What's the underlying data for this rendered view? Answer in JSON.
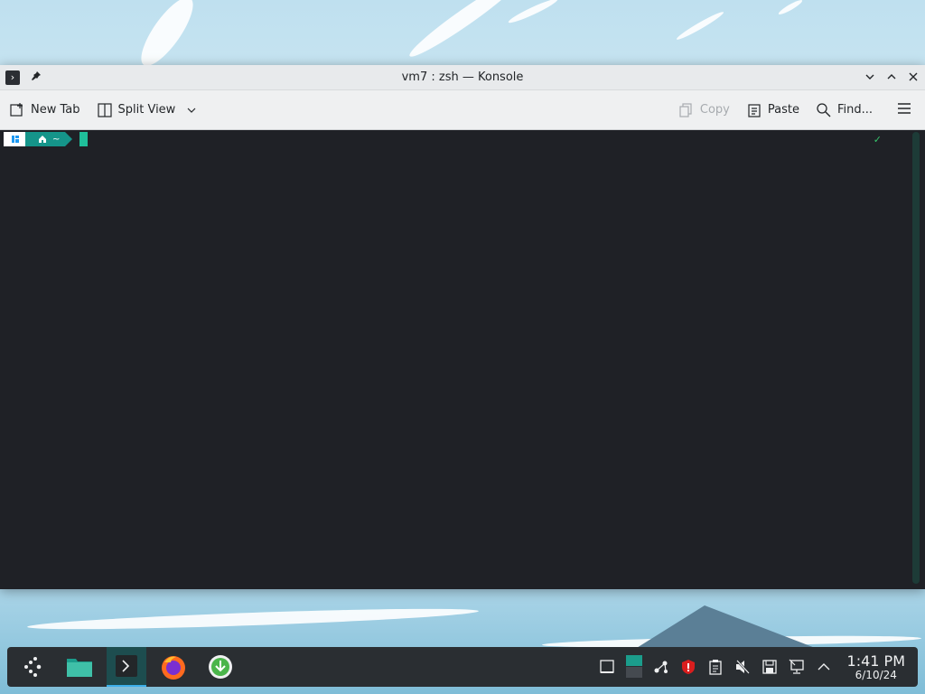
{
  "window": {
    "title": "vm7 : zsh — Konsole"
  },
  "toolbar": {
    "new_tab": "New Tab",
    "split_view": "Split View",
    "copy": "Copy",
    "paste": "Paste",
    "find": "Find..."
  },
  "terminal": {
    "prompt_dir": "~",
    "status": "✓"
  },
  "clock": {
    "time": "1:41 PM",
    "date": "6/10/24"
  },
  "colors": {
    "accent": "#15958a",
    "cursor": "#1fbf9a",
    "terminal_bg": "#1f2126",
    "panel_bg": "#2a2e32"
  }
}
